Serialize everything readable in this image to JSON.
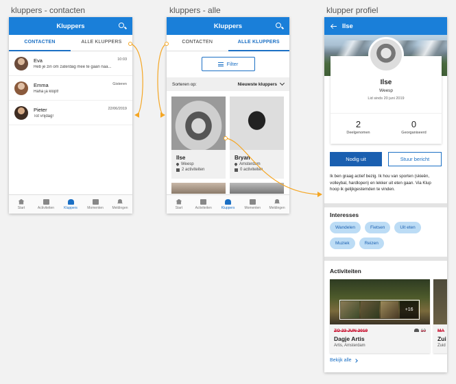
{
  "boards": {
    "contacts_label": "kluppers - contacten",
    "all_label": "kluppers - alle",
    "profile_label": "klupper profiel"
  },
  "colors": {
    "accent": "#1a7fd9",
    "flow": "#f5a623",
    "chip_bg": "#bcdcf5",
    "date_red": "#c8102e"
  },
  "screen1": {
    "title": "Kluppers",
    "tabs": [
      "CONTACTEN",
      "ALLE KLUPPERS"
    ],
    "chats": [
      {
        "name": "Eva",
        "msg": "Heb je zin om zaterdag mee te gaan naa...",
        "time": "10:03"
      },
      {
        "name": "Emma",
        "msg": "Haha ja klopt!",
        "time": "Gisteren"
      },
      {
        "name": "Pieter",
        "msg": "Tot vrijdag!",
        "time": "22/06/2019"
      }
    ]
  },
  "nav": [
    "Start",
    "Activiteiten",
    "Kluppers",
    "Momenten",
    "Meldingen"
  ],
  "screen2": {
    "title": "Kluppers",
    "tabs": [
      "CONTACTEN",
      "ALLE KLUPPERS"
    ],
    "filter": "Filter",
    "sort_label": "Sorteren op:",
    "sort_value": "Nieuwste kluppers",
    "cards": [
      {
        "name": "Ilse",
        "city": "Weesp",
        "acts": "2 activiteiten"
      },
      {
        "name": "Bryan",
        "city": "Amsterdam",
        "acts": "0 activiteiten"
      }
    ]
  },
  "screen3": {
    "title": "Ilse",
    "name": "Ilse",
    "city": "Weesp",
    "since": "Lid sinds 20 juni 2019",
    "stats": [
      {
        "num": "2",
        "label": "Deelgenomen"
      },
      {
        "num": "0",
        "label": "Georganiseerd"
      }
    ],
    "invite": "Nodig uit",
    "message": "Stuur bericht",
    "bio": "Ik ben graag actief bezig. Ik hou van sporten (skieën, volleybal, hardlopen) en lekker uit eten gaan. Via Klup hoop ik gelijkgestemden te vinden.",
    "interests_title": "Interesses",
    "interests": [
      "Wandelen",
      "Fietsen",
      "Uit eten",
      "Muziek",
      "Reizen"
    ],
    "activities_title": "Activiteiten",
    "activity": {
      "date": "ZO 23 JUN 2019",
      "count": "10",
      "title": "Dagje Artis",
      "loc": "Artis, Amsterdam",
      "more": "+16"
    },
    "activity_peek": {
      "date": "MA",
      "title": "Zui",
      "loc": "Zuid"
    },
    "see_all": "Bekijk alle"
  }
}
